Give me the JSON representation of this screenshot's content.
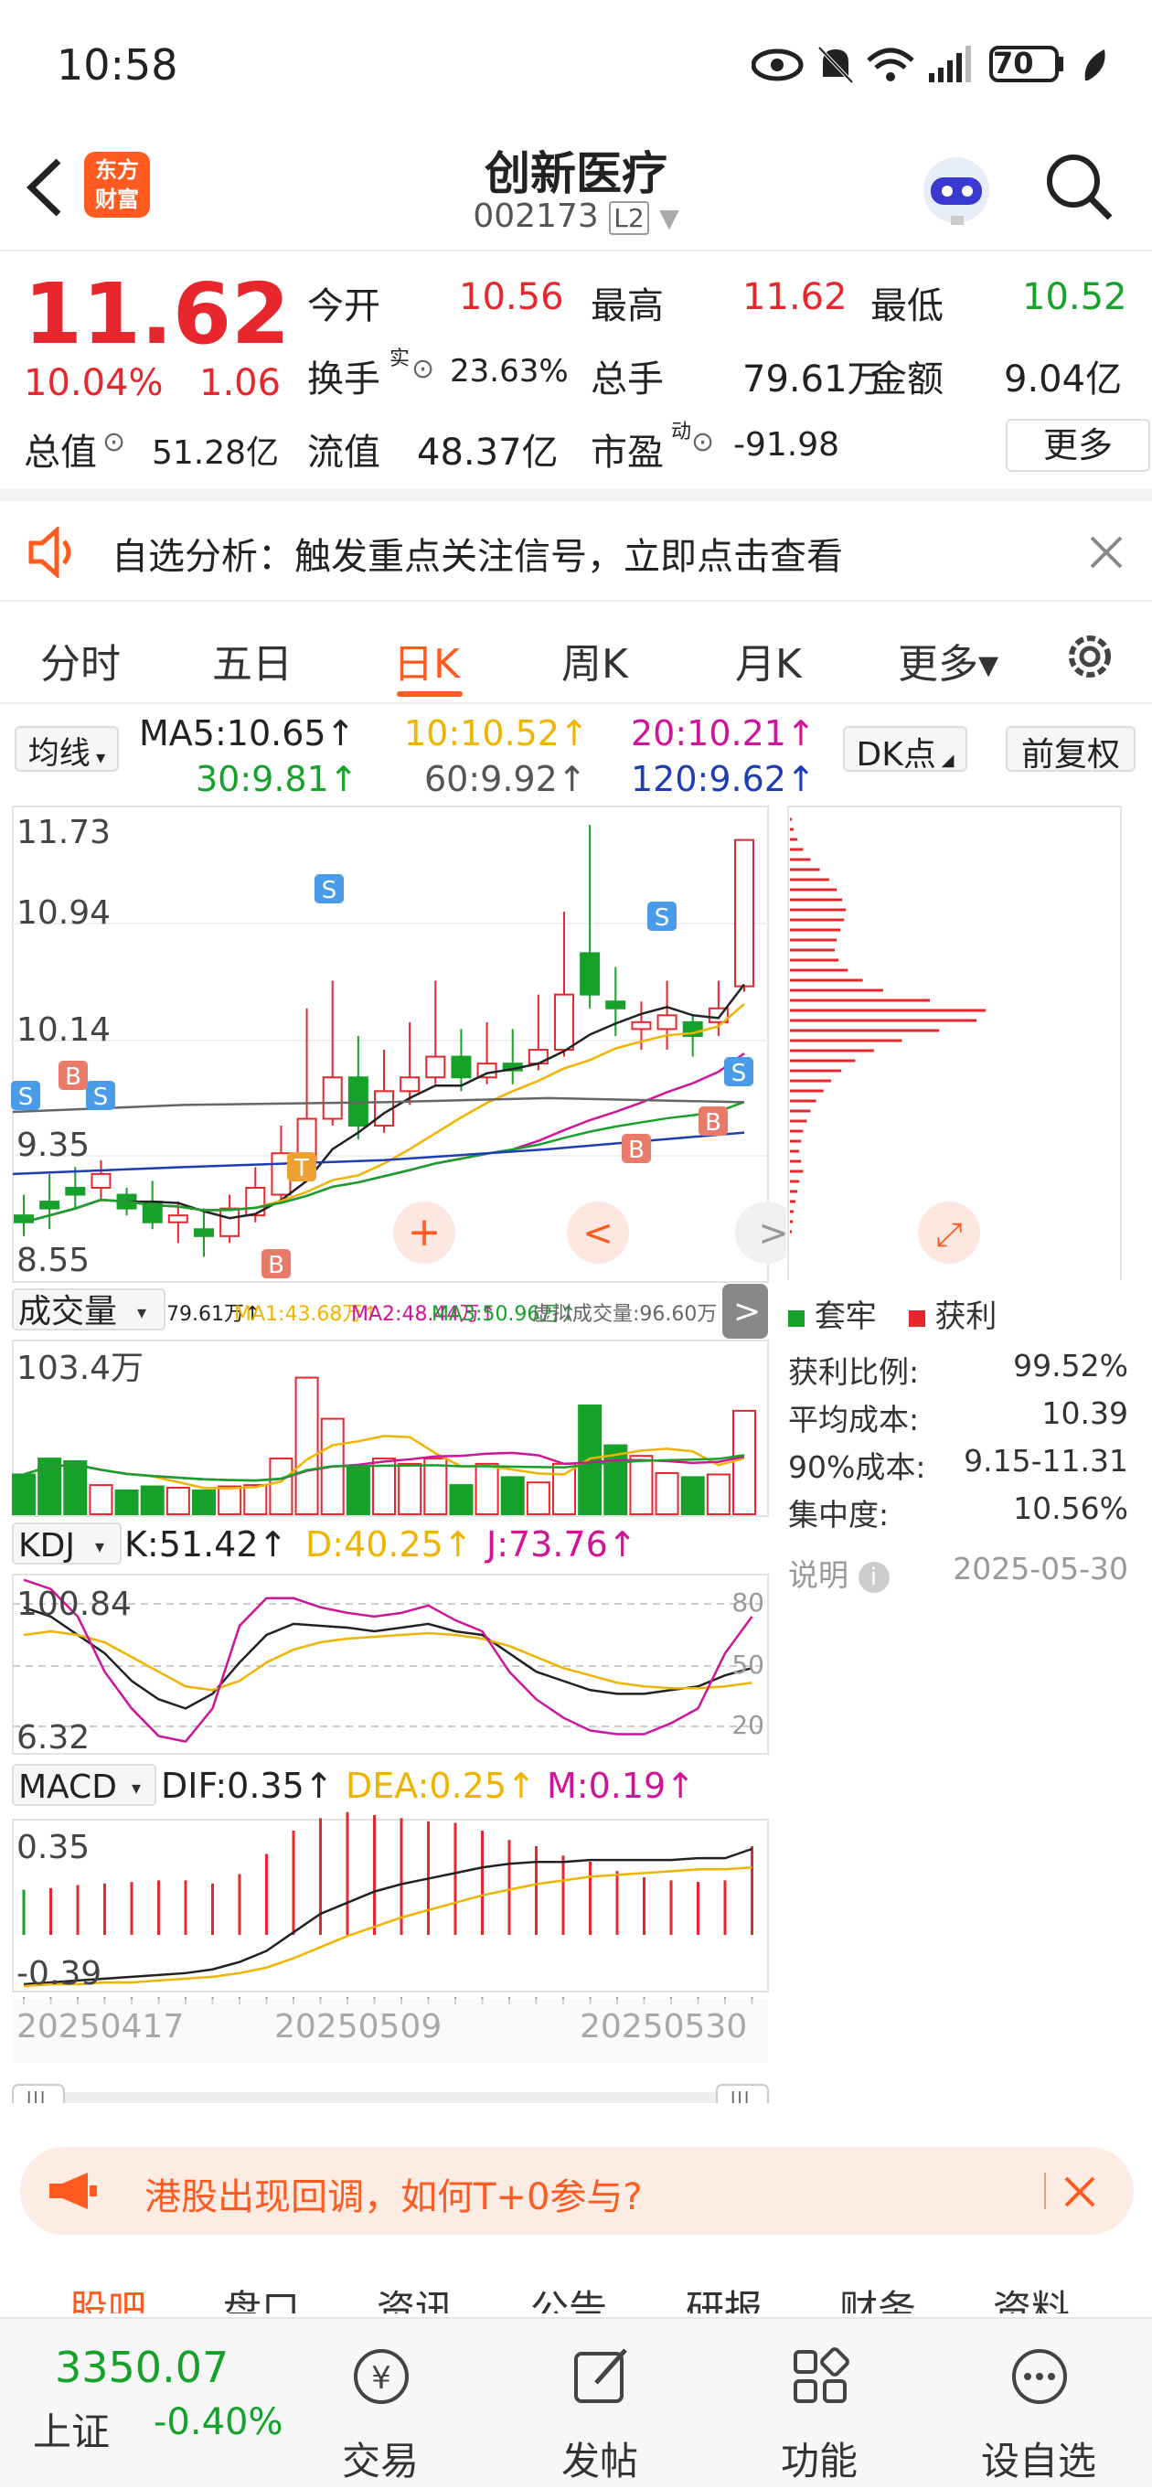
{
  "status": {
    "time": "10:58",
    "battery": "70"
  },
  "header": {
    "title": "创新医疗",
    "code": "002173",
    "level": "L2",
    "logo_line1": "东方",
    "logo_line2": "财富"
  },
  "quote": {
    "price": "11.62",
    "change_pct": "10.04%",
    "change": "1.06",
    "open_label": "今开",
    "open": "10.56",
    "high_label": "最高",
    "high": "11.62",
    "low_label": "最低",
    "low": "10.52",
    "turnover_label": "换手",
    "turnover_sup": "实",
    "turnover": "23.63%",
    "volume_label": "总手",
    "volume": "79.61万",
    "amount_label": "金额",
    "amount": "9.04亿",
    "mcap_label": "总值",
    "mcap": "51.28亿",
    "float_label": "流值",
    "float": "48.37亿",
    "pe_label": "市盈",
    "pe_sup": "动",
    "pe": "-91.98",
    "more": "更多"
  },
  "alert": {
    "text": "自选分析：触发重点关注信号，立即点击查看"
  },
  "tabs": [
    "分时",
    "五日",
    "日K",
    "周K",
    "月K",
    "更多▾"
  ],
  "active_tab": "日K",
  "ma": {
    "selector": "均线",
    "ma5": "MA5:10.65↑",
    "ma10": "10:10.52↑",
    "ma20": "20:10.21↑",
    "ma30": "30:9.81↑",
    "ma60": "60:9.92↑",
    "ma120": "120:9.62↑",
    "dk": "DK点",
    "fq": "前复权"
  },
  "price_axis": [
    "11.73",
    "10.94",
    "10.14",
    "9.35",
    "8.55"
  ],
  "volume_bar": {
    "selector": "成交量",
    "text": "79.61万↑",
    "ma1": "MA1:43.68万↑",
    "ma2": "MA2:48.44万↑",
    "ma3": "MA3:50.96万↑",
    "virtual": "虚拟成交量:96.60万",
    "axis_max": "103.4万"
  },
  "kdj": {
    "selector": "KDJ",
    "k": "K:51.42↑",
    "d": "D:40.25↑",
    "j": "J:73.76↑",
    "axis_max": "100.84",
    "axis_min": "6.32",
    "levels": [
      "80",
      "50",
      "20"
    ]
  },
  "macd": {
    "selector": "MACD",
    "dif": "DIF:0.35↑",
    "dea": "DEA:0.25↑",
    "m": "M:0.19↑",
    "axis_max": "0.35",
    "axis_min": "-0.39"
  },
  "dates": [
    "20250417",
    "20250509",
    "20250530"
  ],
  "chip": {
    "legend_trapped": "套牢",
    "legend_profit": "获利",
    "rows": [
      {
        "label": "获利比例:",
        "value": "99.52%"
      },
      {
        "label": "平均成本:",
        "value": "10.39"
      },
      {
        "label": "90%成本:",
        "value": "9.15-11.31"
      },
      {
        "label": "集中度:",
        "value": "10.56%"
      }
    ],
    "note": "说明",
    "date": "2025-05-30"
  },
  "banner": {
    "text": "港股出现回调，如何T+0参与?"
  },
  "bottom_tabs": [
    "股吧",
    "盘口",
    "资讯",
    "公告",
    "研报",
    "财务",
    "资料"
  ],
  "nav": {
    "index_value": "3350.07",
    "index_name": "上证",
    "index_change": "-0.40%",
    "items": [
      "交易",
      "发帖",
      "功能",
      "设自选"
    ]
  },
  "colors": {
    "up": "#e8262d",
    "down": "#16a12b",
    "accent": "#ff5a1f",
    "ma5": "#222222",
    "ma10": "#f0b400",
    "ma20": "#d0149a",
    "ma30": "#16a12b",
    "ma60": "#666666",
    "ma120": "#1e3cb4"
  }
}
